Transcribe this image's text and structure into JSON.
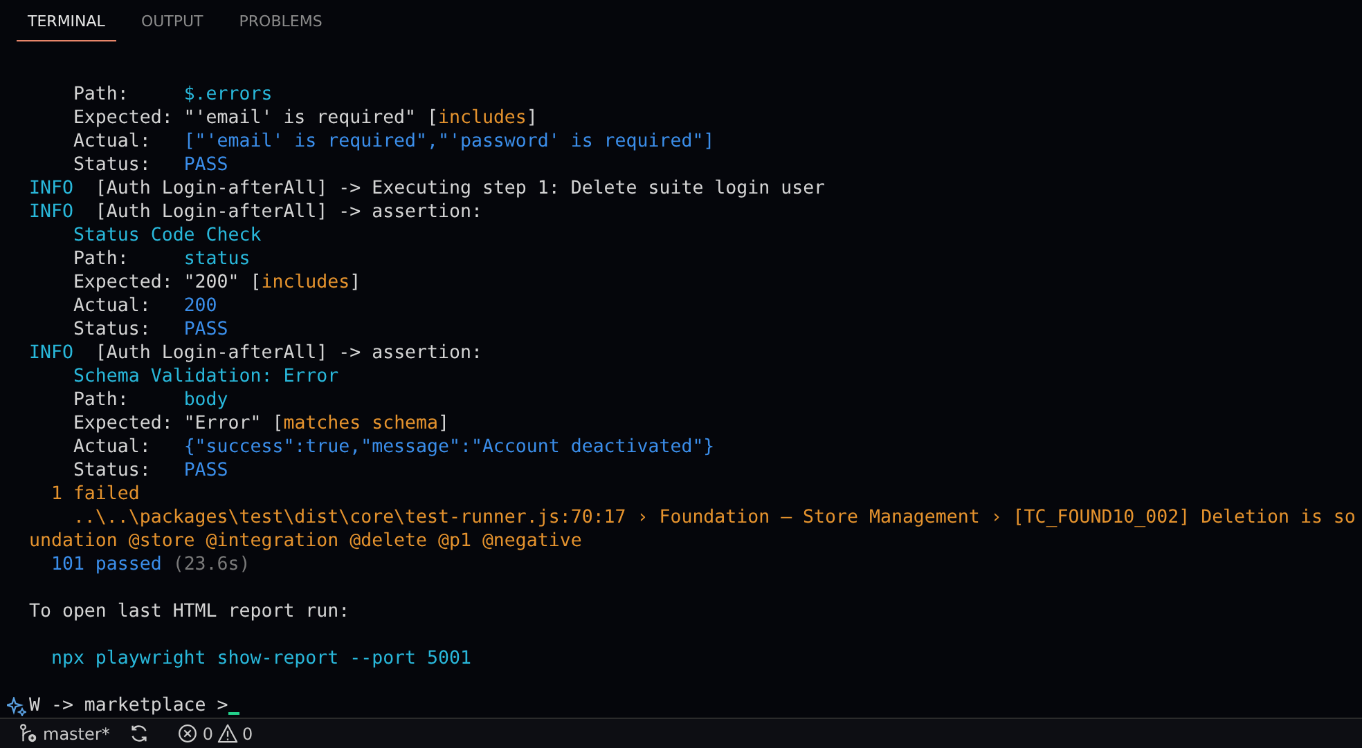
{
  "tabs": [
    {
      "label": "TERMINAL",
      "selected": true
    },
    {
      "label": "OUTPUT",
      "selected": false
    },
    {
      "label": "PROBLEMS",
      "selected": false
    }
  ],
  "terminal": {
    "lines": [
      {
        "kind": "text",
        "segments": [
          {
            "text": "    Path:     ",
            "color": "#d4d4d4"
          },
          {
            "text": "$.errors",
            "color": "#29b8db"
          }
        ]
      },
      {
        "kind": "text",
        "segments": [
          {
            "text": "    Expected: \"'email' is required\" [",
            "color": "#d4d4d4"
          },
          {
            "text": "includes",
            "color": "#e5932e"
          },
          {
            "text": "]",
            "color": "#d4d4d4"
          }
        ]
      },
      {
        "kind": "text",
        "segments": [
          {
            "text": "    Actual:   ",
            "color": "#d4d4d4"
          },
          {
            "text": "[\"'email' is required\",\"'password' is required\"]",
            "color": "#3b8eea"
          }
        ]
      },
      {
        "kind": "text",
        "segments": [
          {
            "text": "    Status:   ",
            "color": "#d4d4d4"
          },
          {
            "text": "PASS",
            "color": "#3b8eea"
          }
        ]
      },
      {
        "kind": "text",
        "segments": [
          {
            "text": "INFO",
            "color": "#29b8db"
          },
          {
            "text": "  [Auth Login-afterAll] -> Executing step 1: Delete suite login user",
            "color": "#d4d4d4"
          }
        ]
      },
      {
        "kind": "text",
        "segments": [
          {
            "text": "INFO",
            "color": "#29b8db"
          },
          {
            "text": "  [Auth Login-afterAll] -> assertion:",
            "color": "#d4d4d4"
          }
        ]
      },
      {
        "kind": "text",
        "segments": [
          {
            "text": "    Status Code Check",
            "color": "#29b8db"
          }
        ]
      },
      {
        "kind": "text",
        "segments": [
          {
            "text": "    Path:     ",
            "color": "#d4d4d4"
          },
          {
            "text": "status",
            "color": "#29b8db"
          }
        ]
      },
      {
        "kind": "text",
        "segments": [
          {
            "text": "    Expected: \"200\" [",
            "color": "#d4d4d4"
          },
          {
            "text": "includes",
            "color": "#e5932e"
          },
          {
            "text": "]",
            "color": "#d4d4d4"
          }
        ]
      },
      {
        "kind": "text",
        "segments": [
          {
            "text": "    Actual:   ",
            "color": "#d4d4d4"
          },
          {
            "text": "200",
            "color": "#3b8eea"
          }
        ]
      },
      {
        "kind": "text",
        "segments": [
          {
            "text": "    Status:   ",
            "color": "#d4d4d4"
          },
          {
            "text": "PASS",
            "color": "#3b8eea"
          }
        ]
      },
      {
        "kind": "text",
        "segments": [
          {
            "text": "INFO",
            "color": "#29b8db"
          },
          {
            "text": "  [Auth Login-afterAll] -> assertion:",
            "color": "#d4d4d4"
          }
        ]
      },
      {
        "kind": "text",
        "segments": [
          {
            "text": "    Schema Validation: Error",
            "color": "#29b8db"
          }
        ]
      },
      {
        "kind": "text",
        "segments": [
          {
            "text": "    Path:     ",
            "color": "#d4d4d4"
          },
          {
            "text": "body",
            "color": "#29b8db"
          }
        ]
      },
      {
        "kind": "text",
        "segments": [
          {
            "text": "    Expected: \"Error\" [",
            "color": "#d4d4d4"
          },
          {
            "text": "matches schema",
            "color": "#e5932e"
          },
          {
            "text": "]",
            "color": "#d4d4d4"
          }
        ]
      },
      {
        "kind": "text",
        "segments": [
          {
            "text": "    Actual:   ",
            "color": "#d4d4d4"
          },
          {
            "text": "{\"success\":true,\"message\":\"Account deactivated\"}",
            "color": "#3b8eea"
          }
        ]
      },
      {
        "kind": "text",
        "segments": [
          {
            "text": "    Status:   ",
            "color": "#d4d4d4"
          },
          {
            "text": "PASS",
            "color": "#3b8eea"
          }
        ]
      },
      {
        "kind": "text",
        "segments": [
          {
            "text": "  1 failed",
            "color": "#e5932e"
          }
        ]
      },
      {
        "kind": "text",
        "segments": [
          {
            "text": "    ..\\..\\packages\\test\\dist\\core\\test-runner.js:70:17 › Foundation – Store Management › [TC_FOUND10_002] Deletion is so",
            "color": "#e5932e"
          }
        ]
      },
      {
        "kind": "text",
        "segments": [
          {
            "text": "undation @store @integration @delete @p1 @negative",
            "color": "#e5932e"
          }
        ]
      },
      {
        "kind": "text",
        "segments": [
          {
            "text": "  101 passed",
            "color": "#3b8eea"
          },
          {
            "text": " (23.6s)",
            "color": "#7a7a7a"
          }
        ]
      },
      {
        "kind": "blank"
      },
      {
        "kind": "text",
        "segments": [
          {
            "text": "To open last HTML report run:",
            "color": "#d4d4d4"
          }
        ]
      },
      {
        "kind": "blank"
      },
      {
        "kind": "text",
        "segments": [
          {
            "text": "  npx playwright show-report --port 5001",
            "color": "#29b8db"
          }
        ]
      },
      {
        "kind": "blank"
      }
    ],
    "prompt": "W -> marketplace >"
  },
  "status_bar": {
    "branch": "master*",
    "errors": "0",
    "warnings": "0"
  }
}
